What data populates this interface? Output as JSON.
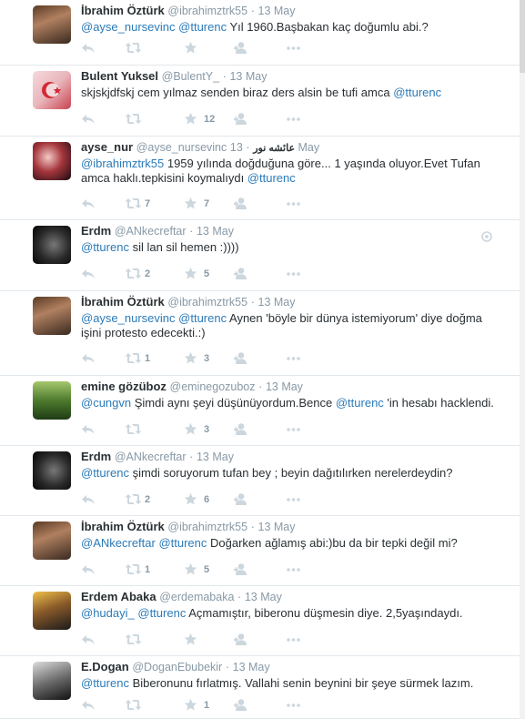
{
  "colors": {
    "link": "#2b7bb9",
    "muted": "#8899a6",
    "icon": "#ccd6dd",
    "text": "#292f33",
    "divider": "#e1e8ed"
  },
  "icons": {
    "reply": "reply-icon",
    "retweet": "retweet-icon",
    "favorite": "star-icon",
    "follow": "follow-user-icon",
    "more": "more-options-icon"
  },
  "tweets": [
    {
      "name": "İbrahim Öztürk",
      "handle": "@ibrahimztrk55",
      "sep": "·",
      "time": "13 May",
      "text": [
        {
          "t": "@ayse_nursevinc",
          "m": true
        },
        {
          "t": " ",
          "m": false
        },
        {
          "t": "@tturenc",
          "m": true
        },
        {
          "t": " Yıl 1960.Başbakan kaç doğumlu abi.?",
          "m": false
        }
      ],
      "retweets": "",
      "favorites": ""
    },
    {
      "name": "Bulent Yuksel",
      "handle": "@BulentY_",
      "sep": "·",
      "time": "13 May",
      "text": [
        {
          "t": "skjskjdfskj cem yılmaz senden biraz ders alsin  be tufi amca ",
          "m": false
        },
        {
          "t": "@tturenc",
          "m": true
        }
      ],
      "retweets": "",
      "favorites": "12"
    },
    {
      "name": "ayse_nur",
      "handle": "@ayse_nursevinc",
      "extra_name": "عائشه نور",
      "sep": "·",
      "time": "13 May",
      "text": [
        {
          "t": "@ibrahimztrk55",
          "m": true
        },
        {
          "t": " 1959 yılında doğduğuna göre... 1 yaşında oluyor.Evet Tufan amca haklı.tepkisini koymalıydı  ",
          "m": false
        },
        {
          "t": "@tturenc",
          "m": true
        }
      ],
      "retweets": "7",
      "favorites": "7"
    },
    {
      "name": "Erdm",
      "handle": "@ANkecreftar",
      "sep": "·",
      "time": "13 May",
      "text": [
        {
          "t": "@tturenc",
          "m": true
        },
        {
          "t": " sil lan sil hemen :))))",
          "m": false
        }
      ],
      "retweets": "2",
      "favorites": "5",
      "corner_icon": "info-circle-icon"
    },
    {
      "name": "İbrahim Öztürk",
      "handle": "@ibrahimztrk55",
      "sep": "·",
      "time": "13 May",
      "text": [
        {
          "t": "@ayse_nursevinc",
          "m": true
        },
        {
          "t": " ",
          "m": false
        },
        {
          "t": "@tturenc",
          "m": true
        },
        {
          "t": " Aynen 'böyle bir dünya istemiyorum' diye doğma işini protesto edecekti.:)",
          "m": false
        }
      ],
      "retweets": "1",
      "favorites": "3"
    },
    {
      "name": "emine gözüboz",
      "handle": "@eminegozuboz",
      "sep": "·",
      "time": "13 May",
      "text": [
        {
          "t": "@cungvn",
          "m": true
        },
        {
          "t": " Şimdi aynı şeyi düşünüyordum.Bence ",
          "m": false
        },
        {
          "t": "@tturenc",
          "m": true
        },
        {
          "t": " 'in hesabı hacklendi.",
          "m": false
        }
      ],
      "retweets": "",
      "favorites": "3"
    },
    {
      "name": "Erdm",
      "handle": "@ANkecreftar",
      "sep": "·",
      "time": "13 May",
      "text": [
        {
          "t": "@tturenc",
          "m": true
        },
        {
          "t": " şimdi soruyorum tufan bey ; beyin dağıtılırken nerelerdeydin?",
          "m": false
        }
      ],
      "retweets": "2",
      "favorites": "6"
    },
    {
      "name": "İbrahim Öztürk",
      "handle": "@ibrahimztrk55",
      "sep": "·",
      "time": "13 May",
      "text": [
        {
          "t": "@ANkecreftar",
          "m": true
        },
        {
          "t": " ",
          "m": false
        },
        {
          "t": "@tturenc",
          "m": true
        },
        {
          "t": " Doğarken ağlamış abi:)bu da bir tepki değil mi?",
          "m": false
        }
      ],
      "retweets": "1",
      "favorites": "5"
    },
    {
      "name": "Erdem Abaka",
      "handle": "@erdemabaka",
      "sep": "·",
      "time": "13 May",
      "text": [
        {
          "t": "@hudayi_",
          "m": true
        },
        {
          "t": " ",
          "m": false
        },
        {
          "t": "@tturenc",
          "m": true
        },
        {
          "t": " Açmamıştır, biberonu düşmesin diye. 2,5yaşındaydı.",
          "m": false
        }
      ],
      "retweets": "",
      "favorites": ""
    },
    {
      "name": "E.Dogan",
      "handle": "@DoganEbubekir",
      "sep": "·",
      "time": "13 May",
      "text": [
        {
          "t": "@tturenc",
          "m": true
        },
        {
          "t": " Biberonunu fırlatmış. Vallahi senin beynini bir şeye sürmek lazım.",
          "m": false
        }
      ],
      "retweets": "",
      "favorites": "1"
    }
  ]
}
